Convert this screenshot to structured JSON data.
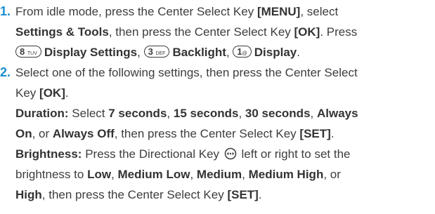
{
  "steps": [
    {
      "number": "1.",
      "lines": {
        "l1_a": "From idle mode, press the Center Select Key ",
        "l1_menu": "[MENU]",
        "l1_b": ", select",
        "l2_settings": "Settings & Tools",
        "l2_a": ", then press the Center Select Key ",
        "l2_ok": "[OK]",
        "l2_b": ". Press",
        "key8_digit": "8",
        "key8_letters": "TUV",
        "l3_display_settings": "Display Settings",
        "l3_sep1": ", ",
        "key3_digit": "3",
        "key3_letters": "DEF",
        "l3_backlight": "Backlight",
        "l3_sep2": ", ",
        "key1_digit": "1",
        "key1_letters": "@",
        "l3_display": "Display",
        "l3_end": "."
      }
    },
    {
      "number": "2.",
      "lines": {
        "l1_a": "Select one of the following settings, then press the Center Select",
        "l2_a": "Key ",
        "l2_ok": "[OK]",
        "l2_end": ".",
        "dur_label": "Duration:",
        "dur_a": " Select ",
        "dur_7": "7 seconds",
        "dur_sep1": ", ",
        "dur_15": "15 seconds",
        "dur_sep2": ", ",
        "dur_30": "30 seconds",
        "dur_sep3": ", ",
        "dur_always": "Always",
        "dur_on": "On",
        "dur_b": ", or ",
        "dur_off": "Always Off",
        "dur_c": ", then press the Center Select Key ",
        "dur_set": "[SET]",
        "dur_end": ".",
        "bri_label": "Brightness:",
        "bri_a": " Press the Directional Key ",
        "bri_b": " left or right to set the",
        "bri_c": "brightness to ",
        "bri_low": "Low",
        "bri_sep1": ", ",
        "bri_medlow": "Medium Low",
        "bri_sep2": ", ",
        "bri_med": "Medium",
        "bri_sep3": ", ",
        "bri_medhigh": "Medium High",
        "bri_d": ", or",
        "bri_high": "High",
        "bri_e": ", then press the Center Select Key ",
        "bri_set": "[SET]",
        "bri_end": "."
      }
    }
  ],
  "icons": {
    "directional_key": "directional-key-icon"
  },
  "colors": {
    "step_number": "#1a8fd0",
    "text": "#3d3d3d"
  }
}
